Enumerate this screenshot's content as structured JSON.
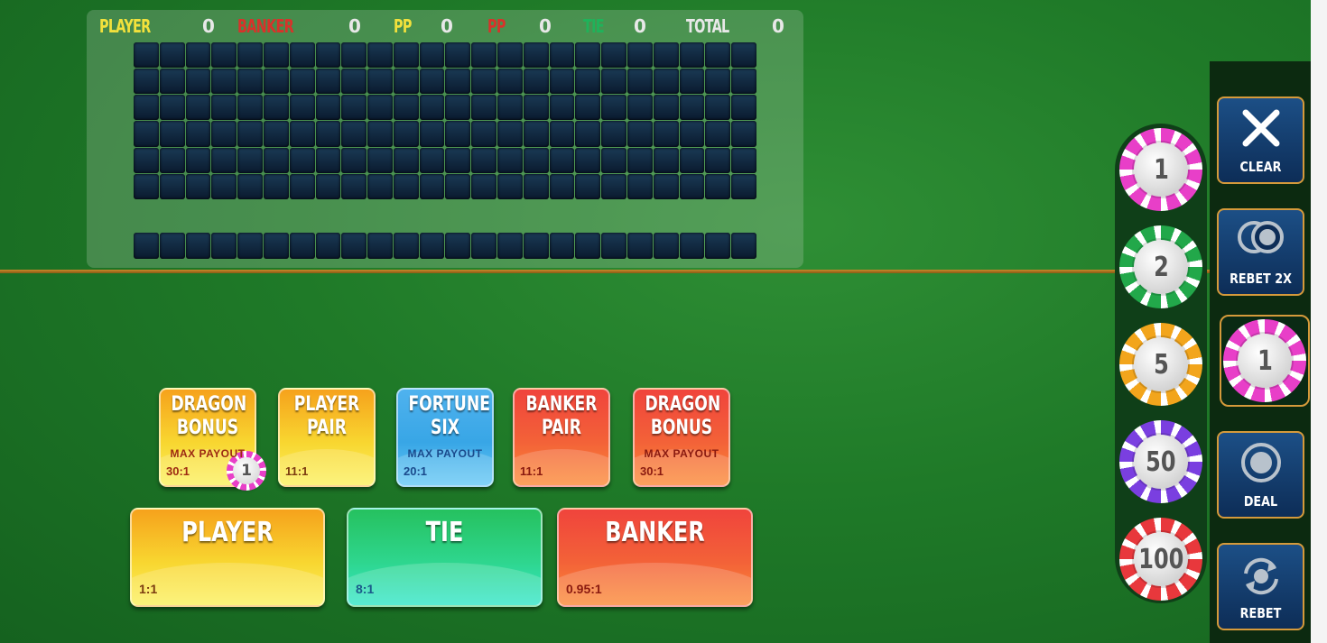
{
  "scoreboard": {
    "player_label": "PLAYER",
    "player_count": "0",
    "banker_label": "BANKER",
    "banker_count": "0",
    "pp1_label": "PP",
    "pp1_count": "0",
    "pp2_label": "PP",
    "pp2_count": "0",
    "tie_label": "TIE",
    "tie_count": "0",
    "total_label": "TOTAL",
    "total_count": "0"
  },
  "side_bets": [
    {
      "name": "DRAGON\nBONUS",
      "max_payout": "MAX PAYOUT",
      "odds": "30:1",
      "theme": "yellow",
      "chip": "1"
    },
    {
      "name": "PLAYER\nPAIR",
      "max_payout": "",
      "odds": "11:1",
      "theme": "yellow"
    },
    {
      "name": "FORTUNE\nSIX",
      "max_payout": "MAX PAYOUT",
      "odds": "20:1",
      "theme": "blue"
    },
    {
      "name": "BANKER\nPAIR",
      "max_payout": "",
      "odds": "11:1",
      "theme": "red"
    },
    {
      "name": "DRAGON\nBONUS",
      "max_payout": "MAX PAYOUT",
      "odds": "30:1",
      "theme": "red"
    }
  ],
  "main_bets": [
    {
      "name": "PLAYER",
      "odds": "1:1"
    },
    {
      "name": "TIE",
      "odds": "8:1"
    },
    {
      "name": "BANKER",
      "odds": "0.95:1"
    }
  ],
  "chips": [
    {
      "value": "1",
      "color": "#e83fc8"
    },
    {
      "value": "2",
      "color": "#22a84a"
    },
    {
      "value": "5",
      "color": "#f2a51c"
    },
    {
      "value": "50",
      "color": "#7a3fe0"
    },
    {
      "value": "100",
      "color": "#e8383c"
    }
  ],
  "selected_chip": {
    "value": "1",
    "color": "#e83fc8"
  },
  "controls": {
    "clear": "CLEAR",
    "rebet2x": "REBET 2X",
    "deal": "DEAL",
    "rebet": "REBET"
  },
  "colors": {
    "player": "#f2e13c",
    "banker": "#d8322a",
    "tie": "#1fb35a",
    "total": "#e8e8e8"
  }
}
